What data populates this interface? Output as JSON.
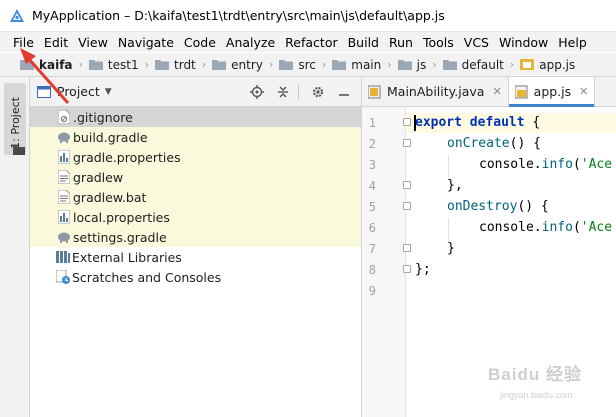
{
  "window": {
    "title": "MyApplication – D:\\kaifa\\test1\\trdt\\entry\\src\\main\\js\\default\\app.js"
  },
  "menu": [
    "File",
    "Edit",
    "View",
    "Navigate",
    "Code",
    "Analyze",
    "Refactor",
    "Build",
    "Run",
    "Tools",
    "VCS",
    "Window",
    "Help"
  ],
  "breadcrumb": [
    "kaifa",
    "test1",
    "trdt",
    "entry",
    "src",
    "main",
    "js",
    "default",
    "app.js"
  ],
  "toolstrip": {
    "label": "1: Project"
  },
  "project_panel": {
    "title": "Project",
    "tree": [
      {
        "label": ".gitignore",
        "icon": "gitignore-file-icon"
      },
      {
        "label": "build.gradle",
        "icon": "gradle-elephant-icon"
      },
      {
        "label": "gradle.properties",
        "icon": "properties-file-icon"
      },
      {
        "label": "gradlew",
        "icon": "text-file-icon"
      },
      {
        "label": "gradlew.bat",
        "icon": "text-file-icon"
      },
      {
        "label": "local.properties",
        "icon": "properties-file-icon"
      },
      {
        "label": "settings.gradle",
        "icon": "gradle-elephant-icon"
      },
      {
        "label": "External Libraries",
        "icon": "library-icon"
      },
      {
        "label": "Scratches and Consoles",
        "icon": "scratches-icon"
      }
    ]
  },
  "editor": {
    "tabs": [
      {
        "label": "MainAbility.java",
        "active": false
      },
      {
        "label": "app.js",
        "active": true
      }
    ],
    "line_numbers": [
      "1",
      "2",
      "3",
      "4",
      "5",
      "6",
      "7",
      "8",
      "9"
    ],
    "code": {
      "l1_kw": "export default",
      "l1_rest": " {",
      "l2_fn": "onCreate",
      "l2_rest": "() {",
      "l3_a": "console.",
      "l3_fn": "info",
      "l3_b": "(",
      "l3_str": "'Ace",
      "l4": "},",
      "l5_fn": "onDestroy",
      "l5_rest": "() {",
      "l6_a": "console.",
      "l6_fn": "info",
      "l6_b": "(",
      "l6_str": "'Ace",
      "l7": "}",
      "l8": "};"
    }
  },
  "watermark": {
    "brand": "Baidu 经验",
    "url": "jingyan.baidu.com"
  },
  "colors": {
    "accent": "#4083c9",
    "keyword": "#0033b3",
    "string": "#067d17",
    "function": "#00627a",
    "arrow": "#e23a2f"
  }
}
